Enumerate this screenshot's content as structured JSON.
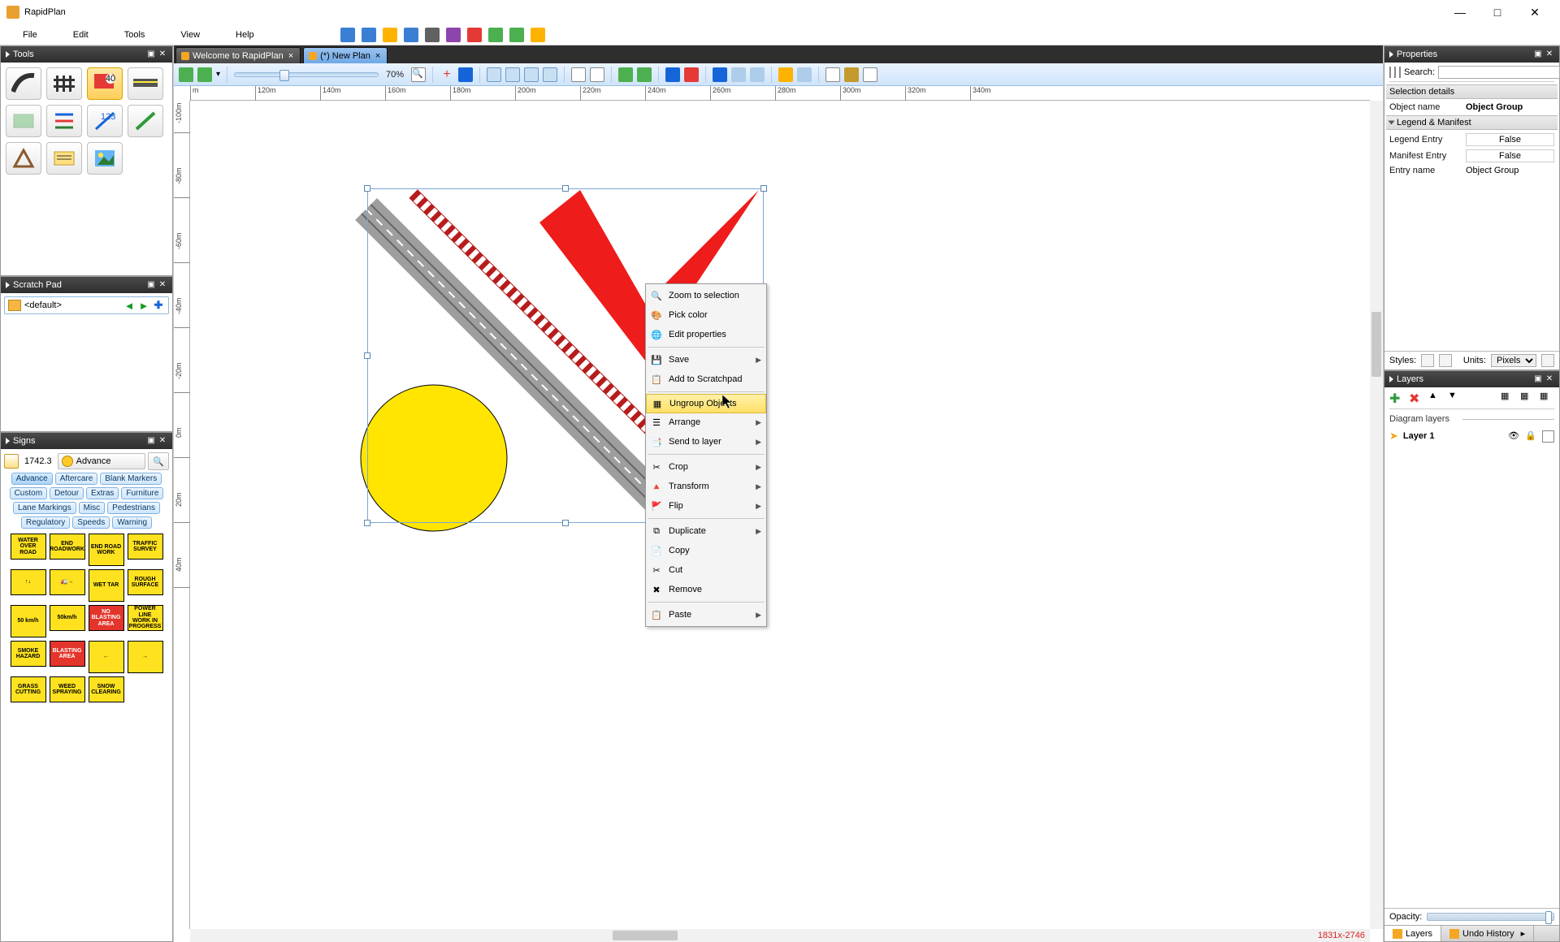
{
  "app": {
    "title": "RapidPlan"
  },
  "window_buttons": {
    "min": "—",
    "max": "□",
    "close": "✕"
  },
  "menu": [
    "File",
    "Edit",
    "Tools",
    "View",
    "Help"
  ],
  "tabs": [
    {
      "label": "Welcome to RapidPlan",
      "active": false
    },
    {
      "label": "(*) New Plan",
      "active": true
    }
  ],
  "zoom": {
    "pct": "70%"
  },
  "ruler_h": [
    "m",
    "120m",
    "140m",
    "160m",
    "180m",
    "200m",
    "220m",
    "240m",
    "260m",
    "280m",
    "300m",
    "320m",
    "340m"
  ],
  "ruler_v": [
    "-100m",
    "-80m",
    "-60m",
    "-40m",
    "-20m",
    "0m",
    "20m",
    "40m"
  ],
  "coord_readout": "1831x-2746",
  "panels": {
    "tools": "Tools",
    "scratch": "Scratch Pad",
    "signs": "Signs",
    "properties": "Properties",
    "layers": "Layers"
  },
  "scratch": {
    "default": "<default>"
  },
  "signs": {
    "version": "1742.3",
    "category": "Advance",
    "chips": [
      "Advance",
      "Aftercare",
      "Blank Markers",
      "Custom",
      "Detour",
      "Extras",
      "Furniture",
      "Lane Markings",
      "Misc",
      "Pedestrians",
      "Regulatory",
      "Speeds",
      "Warning"
    ],
    "grid": [
      {
        "t": "WATER OVER ROAD",
        "c": "yellow"
      },
      {
        "t": "END ROADWORK",
        "c": "yellow"
      },
      {
        "t": "END ROAD WORK",
        "c": "yellow",
        "sq": true
      },
      {
        "t": "TRAFFIC SURVEY",
        "c": "yellow"
      },
      {
        "t": "↑↓",
        "c": "yellow"
      },
      {
        "t": "🚛→",
        "c": "yellow"
      },
      {
        "t": "WET TAR",
        "c": "yellow",
        "sq": true
      },
      {
        "t": "ROUGH SURFACE",
        "c": "yellow"
      },
      {
        "t": "50 km/h",
        "c": "yellow",
        "sq": true
      },
      {
        "t": "50km/h",
        "c": "yellow"
      },
      {
        "t": "NO BLASTING AREA",
        "c": "red"
      },
      {
        "t": "POWER LINE WORK IN PROGRESS",
        "c": "yellow"
      },
      {
        "t": "SMOKE HAZARD",
        "c": "yellow"
      },
      {
        "t": "BLASTING AREA",
        "c": "red"
      },
      {
        "t": "←",
        "c": "yellow",
        "sq": true
      },
      {
        "t": "→",
        "c": "yellow",
        "sq": true
      },
      {
        "t": "GRASS CUTTING",
        "c": "yellow"
      },
      {
        "t": "WEED SPRAYING",
        "c": "yellow"
      },
      {
        "t": "SNOW CLEARING",
        "c": "yellow"
      }
    ]
  },
  "context_menu": [
    {
      "label": "Zoom to selection",
      "icon": "zoom",
      "sub": false
    },
    {
      "label": "Pick color",
      "icon": "color",
      "sub": false
    },
    {
      "label": "Edit properties",
      "icon": "props",
      "sub": false,
      "sep_after": true
    },
    {
      "label": "Save",
      "icon": "save",
      "sub": true
    },
    {
      "label": "Add to Scratchpad",
      "icon": "scratch",
      "sub": false,
      "sep_after": true
    },
    {
      "label": "Ungroup Objects",
      "icon": "ungroup",
      "sub": false,
      "hi": true
    },
    {
      "label": "Arrange",
      "icon": "arrange",
      "sub": true
    },
    {
      "label": "Send to layer",
      "icon": "layer",
      "sub": true,
      "sep_after": true
    },
    {
      "label": "Crop",
      "icon": "crop",
      "sub": true
    },
    {
      "label": "Transform",
      "icon": "transform",
      "sub": true
    },
    {
      "label": "Flip",
      "icon": "flip",
      "sub": true,
      "sep_after": true
    },
    {
      "label": "Duplicate",
      "icon": "dup",
      "sub": true
    },
    {
      "label": "Copy",
      "icon": "copy",
      "sub": false
    },
    {
      "label": "Cut",
      "icon": "cut",
      "sub": false
    },
    {
      "label": "Remove",
      "icon": "remove",
      "sub": false,
      "sep_after": true
    },
    {
      "label": "Paste",
      "icon": "paste",
      "sub": true
    }
  ],
  "properties": {
    "search_label": "Search:",
    "sel_details": "Selection details",
    "obj_name_label": "Object name",
    "obj_name": "Object Group",
    "legend_hdr": "Legend & Manifest",
    "legend_entry_l": "Legend Entry",
    "legend_entry_v": "False",
    "manifest_entry_l": "Manifest Entry",
    "manifest_entry_v": "False",
    "entry_name_l": "Entry name",
    "entry_name_v": "Object Group",
    "styles_l": "Styles:",
    "units_l": "Units:",
    "units_v": "Pixels"
  },
  "layers": {
    "section": "Diagram layers",
    "layer1": "Layer 1",
    "opacity_l": "Opacity:",
    "tabs": [
      "Layers",
      "Undo History"
    ]
  }
}
